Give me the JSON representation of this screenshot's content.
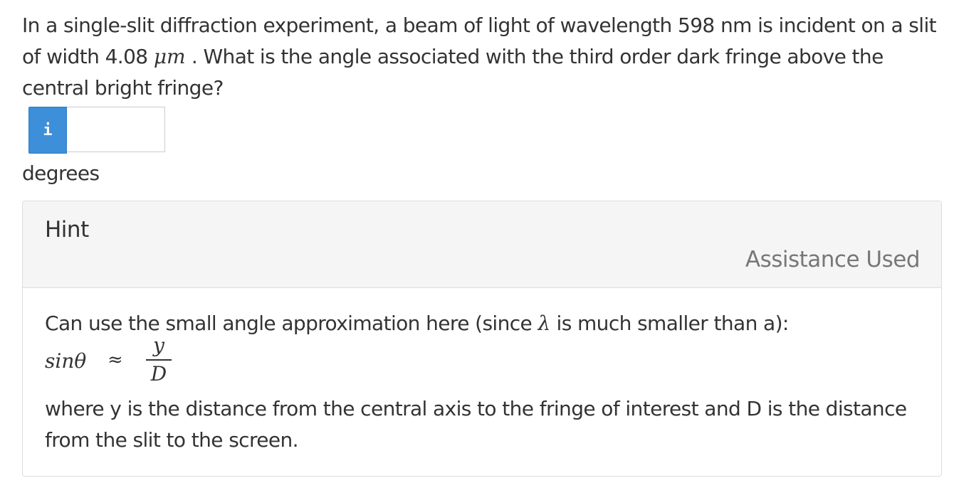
{
  "question": {
    "text_before": "In a single-slit diffraction experiment, a beam of light of wavelength 598 nm is incident on a slit of width 4.08 ",
    "unit_math": "μm",
    "text_after": " . What is the angle associated with the third order dark fringe above the central bright fringe?"
  },
  "answer": {
    "info_label": "i",
    "value": "",
    "unit": "degrees"
  },
  "hint": {
    "title": "Hint",
    "status": "Assistance Used",
    "line1_before": "Can use the small angle approximation here (since ",
    "lambda": "λ",
    "line1_after": " is much smaller than a):",
    "formula": {
      "lhs": "sinθ",
      "approx": "≈",
      "numerator": "y",
      "denominator": "D"
    },
    "line2": "where y is the distance from the central axis to the fringe of interest and D is the distance from the slit to the screen."
  }
}
